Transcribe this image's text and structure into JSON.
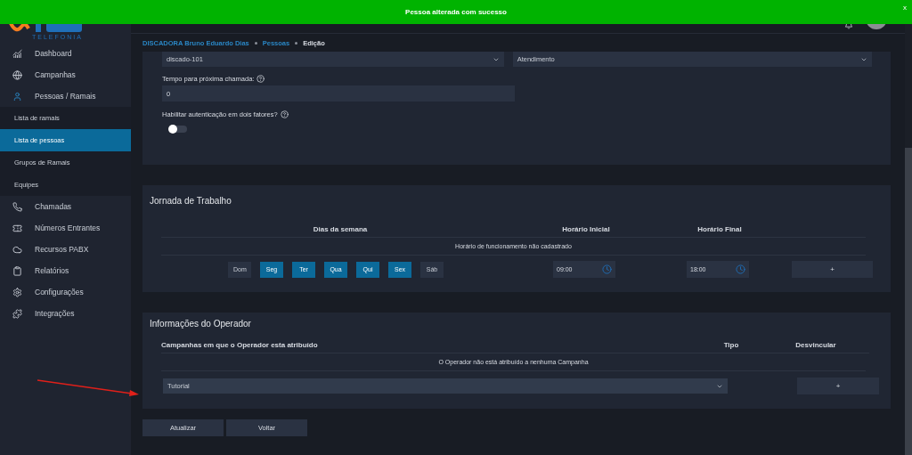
{
  "toast": {
    "message": "Pessoa alterada com sucesso",
    "close": "x"
  },
  "logo": {
    "tagline": "TELEFONIA"
  },
  "breadcrumb": [
    {
      "label": "DISCADORA Bruno Eduardo Dias",
      "current": false
    },
    {
      "label": "Pessoas",
      "current": false
    },
    {
      "label": "Edição",
      "current": true
    }
  ],
  "sidebar": {
    "items": [
      {
        "label": "Dashboard"
      },
      {
        "label": "Campanhas"
      },
      {
        "label": "Pessoas / Ramais",
        "children": [
          {
            "label": "Lista de ramais",
            "selected": false
          },
          {
            "label": "Lista de pessoas",
            "selected": true
          },
          {
            "label": "Grupos de Ramais",
            "selected": false
          },
          {
            "label": "Equipes",
            "selected": false
          }
        ]
      },
      {
        "label": "Chamadas"
      },
      {
        "label": "Números Entrantes"
      },
      {
        "label": "Recursos PABX"
      },
      {
        "label": "Relatórios"
      },
      {
        "label": "Configurações"
      },
      {
        "label": "Integrações"
      }
    ]
  },
  "settings": {
    "selects": [
      {
        "value": "discado-101"
      },
      {
        "value": "Atendimento"
      }
    ],
    "next_call": {
      "label": "Tempo para próxima chamada:",
      "value": "0"
    },
    "two_factor": {
      "label": "Habilitar autenticação em dois fatores?",
      "on": false
    }
  },
  "schedule": {
    "title": "Jornada de Trabalho",
    "columns": [
      "Dias da semana",
      "Horário Inicial",
      "Horário Final"
    ],
    "empty_message": "Horário de funcionamento não cadastrado",
    "days": [
      {
        "label": "Dom",
        "selected": false
      },
      {
        "label": "Seg",
        "selected": true
      },
      {
        "label": "Ter",
        "selected": true
      },
      {
        "label": "Qua",
        "selected": true
      },
      {
        "label": "Qui",
        "selected": true
      },
      {
        "label": "Sex",
        "selected": true
      },
      {
        "label": "Sáb",
        "selected": false
      }
    ],
    "start": "09:00",
    "end": "18:00",
    "add": "+"
  },
  "operator": {
    "title": "Informações do Operador",
    "columns": [
      "Campanhas em que o Operador esta atribuído",
      "Tipo",
      "Desvincular"
    ],
    "empty_message": "O Operador não está atribuído a nenhuma Campanha",
    "campaign": "Tutorial",
    "add": "+"
  },
  "actions": [
    "Atualizar",
    "Voltar"
  ]
}
